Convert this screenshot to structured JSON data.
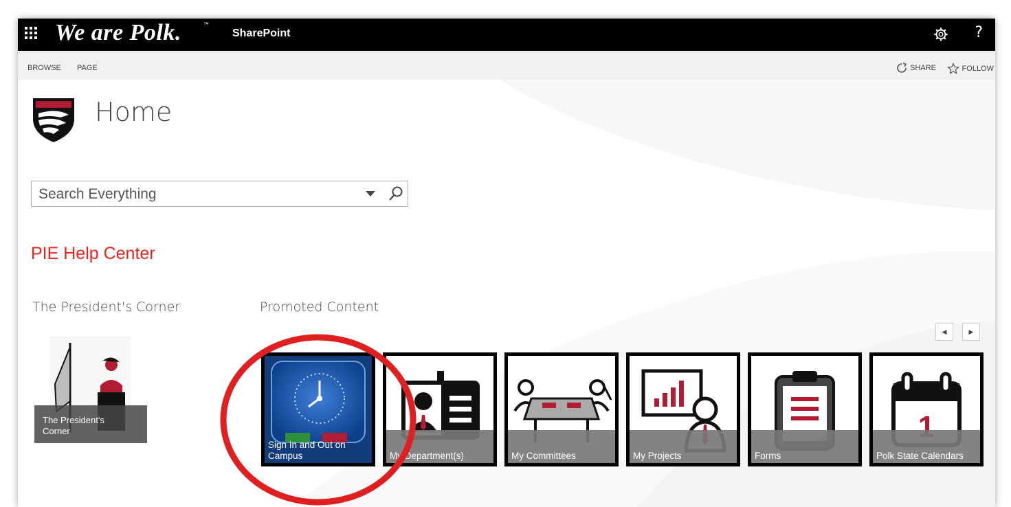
{
  "suite_bar": {
    "brand": "We are Polk.",
    "brand_tm": "™",
    "app_name": "SharePoint",
    "help_label": "?",
    "icons": [
      "waffle-icon",
      "gear-icon",
      "help-icon"
    ]
  },
  "ribbon": {
    "tabs": [
      "BROWSE",
      "PAGE"
    ],
    "share_label": "SHARE",
    "follow_label": "FOLLOW"
  },
  "page": {
    "title": "Home",
    "search_placeholder": "Search Everything",
    "pie_link": "PIE Help Center",
    "presidents_heading": "The President's Corner",
    "promoted_heading": "Promoted Content",
    "presidents_tile": {
      "caption_line1": "The President's",
      "caption_line2": "Corner"
    }
  },
  "promoted_tiles": [
    {
      "caption": "Sign In and Out on",
      "caption2": "Campus",
      "icon": "clock-icon"
    },
    {
      "caption": "My Department(s)",
      "icon": "id-badge-icon"
    },
    {
      "caption": "My Committees",
      "icon": "meeting-table-icon"
    },
    {
      "caption": "My Projects",
      "icon": "presentation-chart-icon"
    },
    {
      "caption": "Forms",
      "icon": "clipboard-icon"
    },
    {
      "caption": "Polk State Calendars",
      "icon": "calendar-icon"
    }
  ],
  "calendar_day": "1",
  "colors": {
    "suite_bar": "#000000",
    "accent_red": "#e8231a",
    "maroon": "#b01c32",
    "annotation_circle": "#e02020"
  }
}
